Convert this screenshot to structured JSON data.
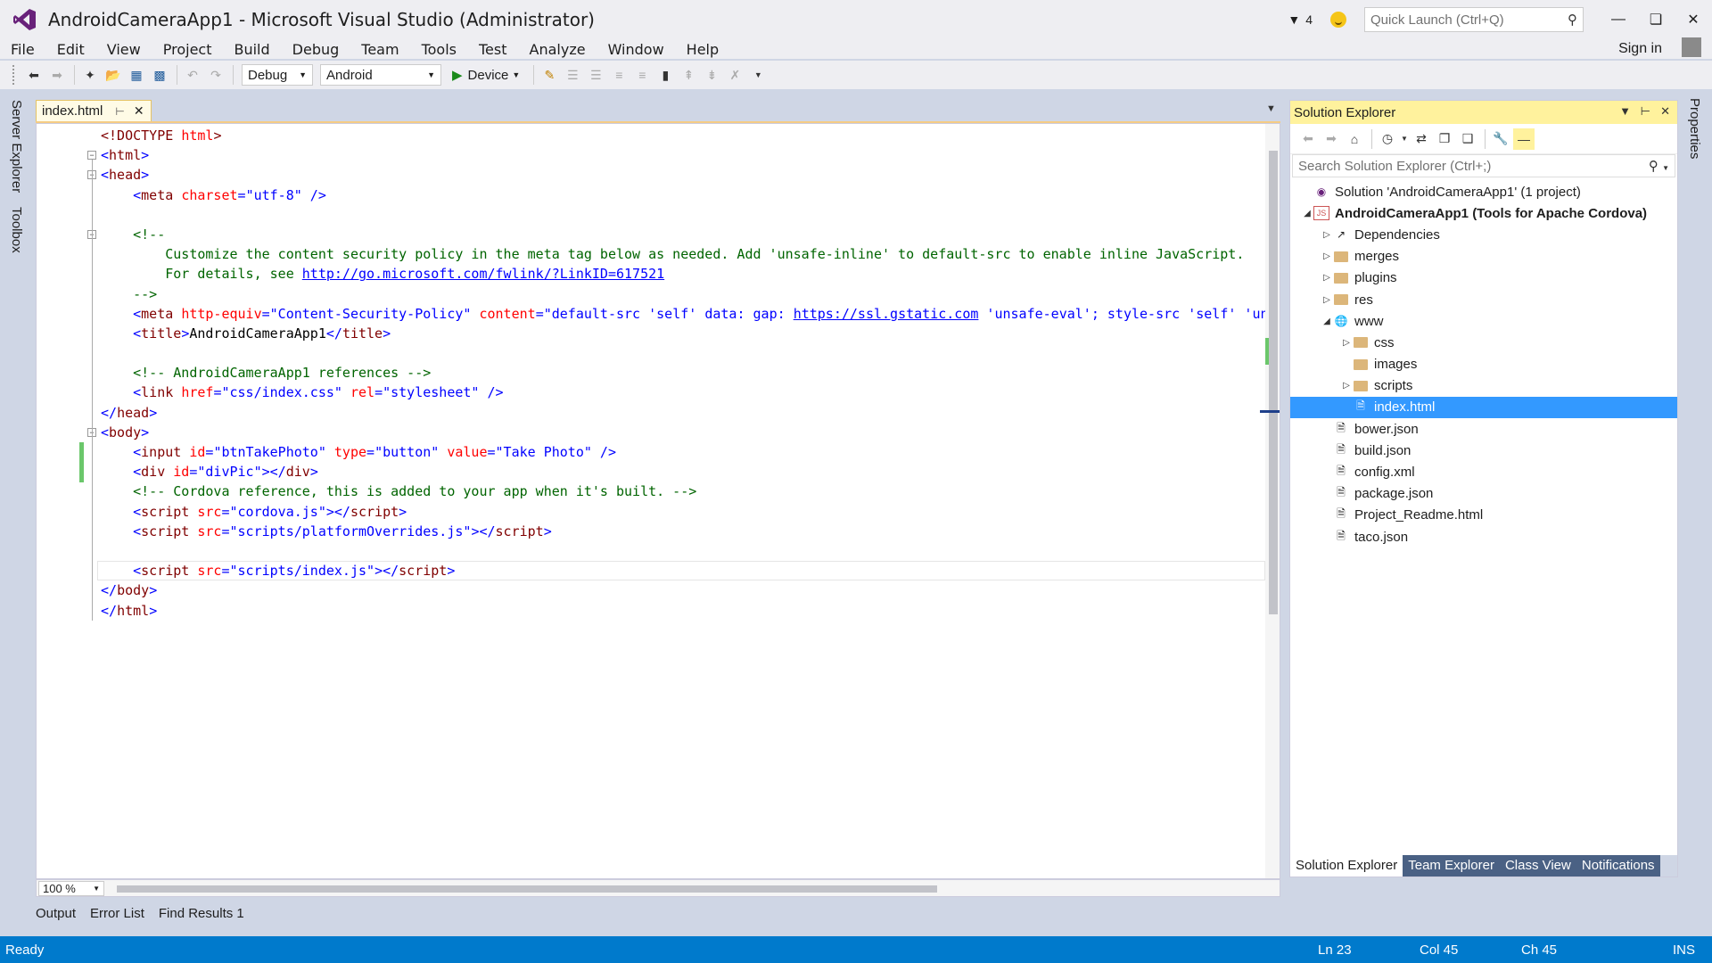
{
  "window": {
    "title": "AndroidCameraApp1 - Microsoft Visual Studio (Administrator)",
    "notification_count": "4",
    "quick_launch_placeholder": "Quick Launch (Ctrl+Q)",
    "sign_in": "Sign in"
  },
  "menu": [
    "File",
    "Edit",
    "View",
    "Project",
    "Build",
    "Debug",
    "Team",
    "Tools",
    "Test",
    "Analyze",
    "Window",
    "Help"
  ],
  "toolbar": {
    "configuration": "Debug",
    "platform": "Android",
    "run_target": "Device"
  },
  "left_rail": [
    "Server Explorer",
    "Toolbox"
  ],
  "right_rail": [
    "Properties"
  ],
  "editor": {
    "tab_name": "index.html",
    "zoom": "100 %",
    "lines": [
      [
        [
          "t",
          "<!DOCTYPE "
        ],
        [
          "a",
          "html"
        ],
        [
          "t",
          ">"
        ]
      ],
      [
        [
          "p",
          "<"
        ],
        [
          "t",
          "html"
        ],
        [
          "p",
          ">"
        ]
      ],
      [
        [
          "p",
          "<"
        ],
        [
          "t",
          "head"
        ],
        [
          "p",
          ">"
        ]
      ],
      [
        [
          "n",
          "    "
        ],
        [
          "p",
          "<"
        ],
        [
          "t",
          "meta "
        ],
        [
          "a",
          "charset"
        ],
        [
          "p",
          "="
        ],
        [
          "v",
          "\"utf-8\""
        ],
        [
          "p",
          " />"
        ]
      ],
      [
        [
          "n",
          ""
        ]
      ],
      [
        [
          "n",
          "    "
        ],
        [
          "c",
          "<!--"
        ]
      ],
      [
        [
          "c",
          "        Customize the content security policy in the meta tag below as needed. Add 'unsafe-inline' to default-src to enable inline JavaScript."
        ]
      ],
      [
        [
          "c",
          "        For details, see "
        ],
        [
          "u",
          "http://go.microsoft.com/fwlink/?LinkID=617521"
        ]
      ],
      [
        [
          "c",
          "    -->"
        ]
      ],
      [
        [
          "n",
          "    "
        ],
        [
          "p",
          "<"
        ],
        [
          "t",
          "meta "
        ],
        [
          "a",
          "http-equiv"
        ],
        [
          "p",
          "="
        ],
        [
          "v",
          "\"Content-Security-Policy\" "
        ],
        [
          "a",
          "content"
        ],
        [
          "p",
          "="
        ],
        [
          "v",
          "\"default-src 'self' data: gap: "
        ],
        [
          "u",
          "https://ssl.gstatic.com"
        ],
        [
          "v",
          " 'unsafe-eval'; style-src 'self' 'un"
        ]
      ],
      [
        [
          "n",
          "    "
        ],
        [
          "p",
          "<"
        ],
        [
          "t",
          "title"
        ],
        [
          "p",
          ">"
        ],
        [
          "n",
          "AndroidCameraApp1"
        ],
        [
          "p",
          "</"
        ],
        [
          "t",
          "title"
        ],
        [
          "p",
          ">"
        ]
      ],
      [
        [
          "n",
          ""
        ]
      ],
      [
        [
          "n",
          "    "
        ],
        [
          "c",
          "<!-- AndroidCameraApp1 references -->"
        ]
      ],
      [
        [
          "n",
          "    "
        ],
        [
          "p",
          "<"
        ],
        [
          "t",
          "link "
        ],
        [
          "a",
          "href"
        ],
        [
          "p",
          "="
        ],
        [
          "v",
          "\"css/index.css\" "
        ],
        [
          "a",
          "rel"
        ],
        [
          "p",
          "="
        ],
        [
          "v",
          "\"stylesheet\""
        ],
        [
          "p",
          " />"
        ]
      ],
      [
        [
          "p",
          "</"
        ],
        [
          "t",
          "head"
        ],
        [
          "p",
          ">"
        ]
      ],
      [
        [
          "p",
          "<"
        ],
        [
          "t",
          "body"
        ],
        [
          "p",
          ">"
        ]
      ],
      [
        [
          "n",
          "    "
        ],
        [
          "p",
          "<"
        ],
        [
          "t",
          "input "
        ],
        [
          "a",
          "id"
        ],
        [
          "p",
          "="
        ],
        [
          "v",
          "\"btnTakePhoto\" "
        ],
        [
          "a",
          "type"
        ],
        [
          "p",
          "="
        ],
        [
          "v",
          "\"button\" "
        ],
        [
          "a",
          "value"
        ],
        [
          "p",
          "="
        ],
        [
          "v",
          "\"Take Photo\""
        ],
        [
          "p",
          " />"
        ]
      ],
      [
        [
          "n",
          "    "
        ],
        [
          "p",
          "<"
        ],
        [
          "t",
          "div "
        ],
        [
          "a",
          "id"
        ],
        [
          "p",
          "="
        ],
        [
          "v",
          "\"divPic\""
        ],
        [
          "p",
          "></"
        ],
        [
          "t",
          "div"
        ],
        [
          "p",
          ">"
        ]
      ],
      [
        [
          "n",
          "    "
        ],
        [
          "c",
          "<!-- Cordova reference, this is added to your app when it's built. -->"
        ]
      ],
      [
        [
          "n",
          "    "
        ],
        [
          "p",
          "<"
        ],
        [
          "t",
          "script "
        ],
        [
          "a",
          "src"
        ],
        [
          "p",
          "="
        ],
        [
          "v",
          "\"cordova.js\""
        ],
        [
          "p",
          "></"
        ],
        [
          "t",
          "script"
        ],
        [
          "p",
          ">"
        ]
      ],
      [
        [
          "n",
          "    "
        ],
        [
          "p",
          "<"
        ],
        [
          "t",
          "script "
        ],
        [
          "a",
          "src"
        ],
        [
          "p",
          "="
        ],
        [
          "v",
          "\"scripts/platformOverrides.js\""
        ],
        [
          "p",
          "></"
        ],
        [
          "t",
          "script"
        ],
        [
          "p",
          ">"
        ]
      ],
      [
        [
          "n",
          ""
        ]
      ],
      [
        [
          "n",
          "    "
        ],
        [
          "p",
          "<"
        ],
        [
          "t",
          "script "
        ],
        [
          "a",
          "src"
        ],
        [
          "p",
          "="
        ],
        [
          "v",
          "\"scripts/index.js\""
        ],
        [
          "p",
          "></"
        ],
        [
          "t",
          "script"
        ],
        [
          "p",
          ">"
        ]
      ],
      [
        [
          "p",
          "</"
        ],
        [
          "t",
          "body"
        ],
        [
          "p",
          ">"
        ]
      ],
      [
        [
          "p",
          "</"
        ],
        [
          "t",
          "html"
        ],
        [
          "p",
          ">"
        ]
      ]
    ]
  },
  "bottom_tabs": [
    "Output",
    "Error List",
    "Find Results 1"
  ],
  "solution_explorer": {
    "title": "Solution Explorer",
    "search_placeholder": "Search Solution Explorer (Ctrl+;)",
    "nodes": [
      {
        "label": "Solution 'AndroidCameraApp1' (1 project)",
        "depth": 0,
        "arrow": "",
        "icon": "solution-icon",
        "bold": false,
        "selected": false
      },
      {
        "label": "AndroidCameraApp1 (Tools for Apache Cordova)",
        "depth": 0,
        "arrow": "open",
        "icon": "js-project-icon",
        "bold": true,
        "selected": false
      },
      {
        "label": "Dependencies",
        "depth": 1,
        "arrow": "closed",
        "icon": "dependencies-icon",
        "bold": false,
        "selected": false
      },
      {
        "label": "merges",
        "depth": 1,
        "arrow": "closed",
        "icon": "folder-icon",
        "bold": false,
        "selected": false
      },
      {
        "label": "plugins",
        "depth": 1,
        "arrow": "closed",
        "icon": "folder-icon",
        "bold": false,
        "selected": false
      },
      {
        "label": "res",
        "depth": 1,
        "arrow": "closed",
        "icon": "folder-icon",
        "bold": false,
        "selected": false
      },
      {
        "label": "www",
        "depth": 1,
        "arrow": "open",
        "icon": "globe-icon",
        "bold": false,
        "selected": false
      },
      {
        "label": "css",
        "depth": 2,
        "arrow": "closed",
        "icon": "folder-icon",
        "bold": false,
        "selected": false
      },
      {
        "label": "images",
        "depth": 2,
        "arrow": "",
        "icon": "folder-icon",
        "bold": false,
        "selected": false
      },
      {
        "label": "scripts",
        "depth": 2,
        "arrow": "closed",
        "icon": "folder-icon",
        "bold": false,
        "selected": false
      },
      {
        "label": "index.html",
        "depth": 2,
        "arrow": "",
        "icon": "html-file-icon",
        "bold": false,
        "selected": true
      },
      {
        "label": "bower.json",
        "depth": 1,
        "arrow": "",
        "icon": "json-file-icon",
        "bold": false,
        "selected": false
      },
      {
        "label": "build.json",
        "depth": 1,
        "arrow": "",
        "icon": "json-file-icon",
        "bold": false,
        "selected": false
      },
      {
        "label": "config.xml",
        "depth": 1,
        "arrow": "",
        "icon": "xml-file-icon",
        "bold": false,
        "selected": false
      },
      {
        "label": "package.json",
        "depth": 1,
        "arrow": "",
        "icon": "json-file-icon",
        "bold": false,
        "selected": false
      },
      {
        "label": "Project_Readme.html",
        "depth": 1,
        "arrow": "",
        "icon": "html-file-icon",
        "bold": false,
        "selected": false
      },
      {
        "label": "taco.json",
        "depth": 1,
        "arrow": "",
        "icon": "json-file-icon",
        "bold": false,
        "selected": false
      }
    ],
    "tabs": [
      "Solution Explorer",
      "Team Explorer",
      "Class View",
      "Notifications"
    ]
  },
  "status": {
    "ready": "Ready",
    "ln": "Ln 23",
    "col": "Col 45",
    "ch": "Ch 45",
    "ins": "INS"
  },
  "colors": {
    "status_bar": "#007acc",
    "selection": "#3399ff",
    "tool_title_active": "#fff29d"
  }
}
